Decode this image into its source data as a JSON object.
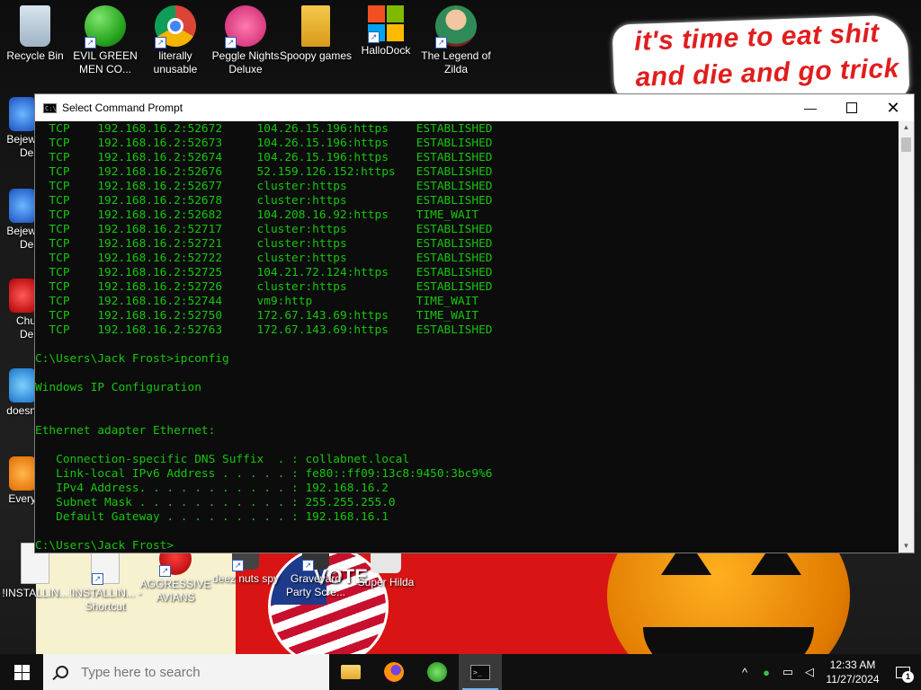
{
  "desktop": {
    "banner_line1": "it's time to eat shit",
    "banner_line2": "and die and go trick",
    "top_icons": [
      {
        "label": "Recycle Bin",
        "icon": "recycle-bin-icon"
      },
      {
        "label": "EVIL GREEN MEN CO...",
        "icon": "green-men-icon"
      },
      {
        "label": "literally unusable",
        "icon": "chrome-icon"
      },
      {
        "label": "Peggle Nights Deluxe",
        "icon": "peggle-icon"
      },
      {
        "label": "Spoopy games",
        "icon": "folder-icon"
      },
      {
        "label": "HalloDock",
        "icon": "windows-logo-icon"
      },
      {
        "label": "The Legend of Zilda",
        "icon": "zilda-icon"
      }
    ],
    "side_icons": [
      {
        "label": "Bejew Del",
        "icon": "bejeweled-icon"
      },
      {
        "label": "Bejew Del",
        "icon": "bejeweled-icon"
      },
      {
        "label": "Chu Del",
        "icon": "chuzzle-icon"
      },
      {
        "label": "doesn",
        "icon": "app-icon"
      },
      {
        "label": "Every",
        "icon": "app-icon"
      }
    ],
    "bottom_icons": [
      {
        "label": "!INSTALLIN...",
        "icon": "document-icon"
      },
      {
        "label": "!INSTALLIN... - Shortcut",
        "icon": "document-icon"
      },
      {
        "label": "AGGRESSIVE AVIANS",
        "icon": "angry-bird-icon"
      },
      {
        "label": "deez nuts spy",
        "icon": "app-icon"
      },
      {
        "label": "Graveyard Party Scre...",
        "icon": "app-icon"
      },
      {
        "label": "Super Hilda",
        "icon": "app-icon"
      }
    ],
    "vote_text": "VOTE"
  },
  "cmd": {
    "title": "Select Command Prompt",
    "netstat": [
      [
        "TCP",
        "192.168.16.2:52672",
        "104.26.15.196:https",
        "ESTABLISHED"
      ],
      [
        "TCP",
        "192.168.16.2:52673",
        "104.26.15.196:https",
        "ESTABLISHED"
      ],
      [
        "TCP",
        "192.168.16.2:52674",
        "104.26.15.196:https",
        "ESTABLISHED"
      ],
      [
        "TCP",
        "192.168.16.2:52676",
        "52.159.126.152:https",
        "ESTABLISHED"
      ],
      [
        "TCP",
        "192.168.16.2:52677",
        "cluster:https",
        "ESTABLISHED"
      ],
      [
        "TCP",
        "192.168.16.2:52678",
        "cluster:https",
        "ESTABLISHED"
      ],
      [
        "TCP",
        "192.168.16.2:52682",
        "104.208.16.92:https",
        "TIME_WAIT"
      ],
      [
        "TCP",
        "192.168.16.2:52717",
        "cluster:https",
        "ESTABLISHED"
      ],
      [
        "TCP",
        "192.168.16.2:52721",
        "cluster:https",
        "ESTABLISHED"
      ],
      [
        "TCP",
        "192.168.16.2:52722",
        "cluster:https",
        "ESTABLISHED"
      ],
      [
        "TCP",
        "192.168.16.2:52725",
        "104.21.72.124:https",
        "ESTABLISHED"
      ],
      [
        "TCP",
        "192.168.16.2:52726",
        "cluster:https",
        "ESTABLISHED"
      ],
      [
        "TCP",
        "192.168.16.2:52744",
        "vm9:http",
        "TIME_WAIT"
      ],
      [
        "TCP",
        "192.168.16.2:52750",
        "172.67.143.69:https",
        "TIME_WAIT"
      ],
      [
        "TCP",
        "192.168.16.2:52763",
        "172.67.143.69:https",
        "ESTABLISHED"
      ]
    ],
    "prompt_ipconfig": "C:\\Users\\Jack Frost>ipconfig",
    "ip_config_title": "Windows IP Configuration",
    "adapter": "Ethernet adapter Ethernet:",
    "ip_lines": [
      "   Connection-specific DNS Suffix  . : collabnet.local",
      "   Link-local IPv6 Address . . . . . : fe80::ff09:13c8:9450:3bc9%6",
      "   IPv4 Address. . . . . . . . . . . : 192.168.16.2",
      "   Subnet Mask . . . . . . . . . . . : 255.255.255.0",
      "   Default Gateway . . . . . . . . . : 192.168.16.1"
    ],
    "prompt_final": "C:\\Users\\Jack Frost>"
  },
  "taskbar": {
    "search_placeholder": "Type here to search",
    "time": "12:33 AM",
    "date": "11/27/2024",
    "notification_count": "1",
    "apps": [
      "file-explorer-icon",
      "firefox-icon",
      "green-men-icon",
      "command-prompt-icon"
    ]
  }
}
